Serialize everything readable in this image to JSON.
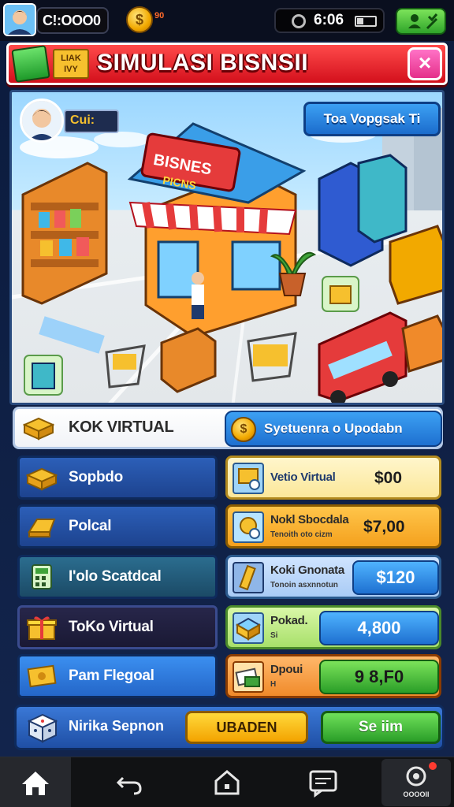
{
  "top_bar": {
    "coins": "C!:OOO0",
    "coin_badge": "$",
    "coin_extra": "90",
    "time": "6:06"
  },
  "banner": {
    "tag": "LIAK  IVY",
    "title": "SIMULASI BISNSII",
    "close_label": "×"
  },
  "scene": {
    "player_name": "Cui:",
    "store_button": "Toa Vopgsak Ti",
    "sign_top": "BISNES",
    "sign_bottom": "PICNS"
  },
  "shop_bar": {
    "title": "KOK VIRTUAL",
    "upgrade_label": "Syetuenra o Upodabn",
    "coin_glyph": "$"
  },
  "categories": [
    {
      "label": "Sopbdo"
    },
    {
      "label": "Polcal"
    },
    {
      "label": "I'olo Scatdcal"
    },
    {
      "label": "ToKo Virtual"
    },
    {
      "label": "Pam Flegoal"
    }
  ],
  "upgrades": [
    {
      "name": "Vetio Virtual",
      "sub": "",
      "price": "$00"
    },
    {
      "name": "Nokl Sbocdala",
      "sub": "Tenoith oto cizm",
      "price": "$7,00"
    },
    {
      "name": "Koki Gnonata",
      "sub": "Tonoin asxnnotun",
      "price": "$120"
    },
    {
      "name": "Pokad.",
      "sub": "Si",
      "price": "4,800"
    },
    {
      "name": "Dpoui",
      "sub": "H",
      "price": "9 8,F0"
    }
  ],
  "action_bar": {
    "label": "Nirika Sepnon",
    "upgrade_button": "UBADEN",
    "sell_button": "Se iim"
  },
  "nav": {
    "right_caption": "OOOOII"
  },
  "colors": {
    "accent_red": "#d3101c",
    "accent_blue": "#1e70d0",
    "accent_green": "#2a9e28",
    "accent_yellow": "#f3a300"
  }
}
